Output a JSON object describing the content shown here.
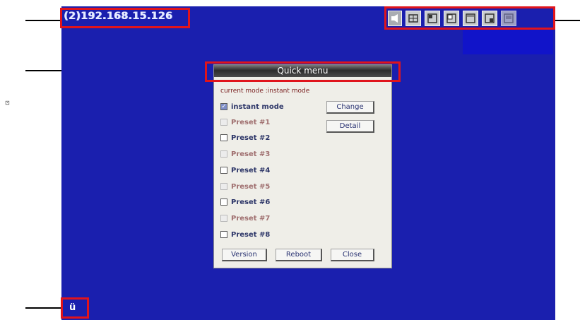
{
  "ip_label": "(2)192.168.15.126",
  "side_mark": "⊡",
  "bottom_glyph": "ü",
  "toolbar": {
    "buttons": [
      {
        "name": "speaker-icon"
      },
      {
        "name": "quad-layout-icon"
      },
      {
        "name": "split-left-icon"
      },
      {
        "name": "split-corner-icon"
      },
      {
        "name": "single-view-icon"
      },
      {
        "name": "pip-layout-icon"
      },
      {
        "name": "fullscreen-icon"
      }
    ]
  },
  "menu": {
    "title": "Quick menu",
    "mode_text": "current mode :instant mode",
    "options": [
      {
        "label": "instant mode",
        "checked": true,
        "style": "normal"
      },
      {
        "label": "Preset #1",
        "checked": false,
        "style": "faded"
      },
      {
        "label": "Preset #2",
        "checked": false,
        "style": "normal"
      },
      {
        "label": "Preset #3",
        "checked": false,
        "style": "faded"
      },
      {
        "label": "Preset #4",
        "checked": false,
        "style": "normal"
      },
      {
        "label": "Preset #5",
        "checked": false,
        "style": "faded"
      },
      {
        "label": "Preset #6",
        "checked": false,
        "style": "normal"
      },
      {
        "label": "Preset #7",
        "checked": false,
        "style": "faded"
      },
      {
        "label": "Preset #8",
        "checked": false,
        "style": "normal"
      }
    ],
    "change_label": "Change",
    "detail_label": "Detail",
    "version_label": "Version",
    "reboot_label": "Reboot",
    "close_label": "Close"
  },
  "colors": {
    "screen_bg": "#1a1fae",
    "highlight": "#e0141c"
  }
}
